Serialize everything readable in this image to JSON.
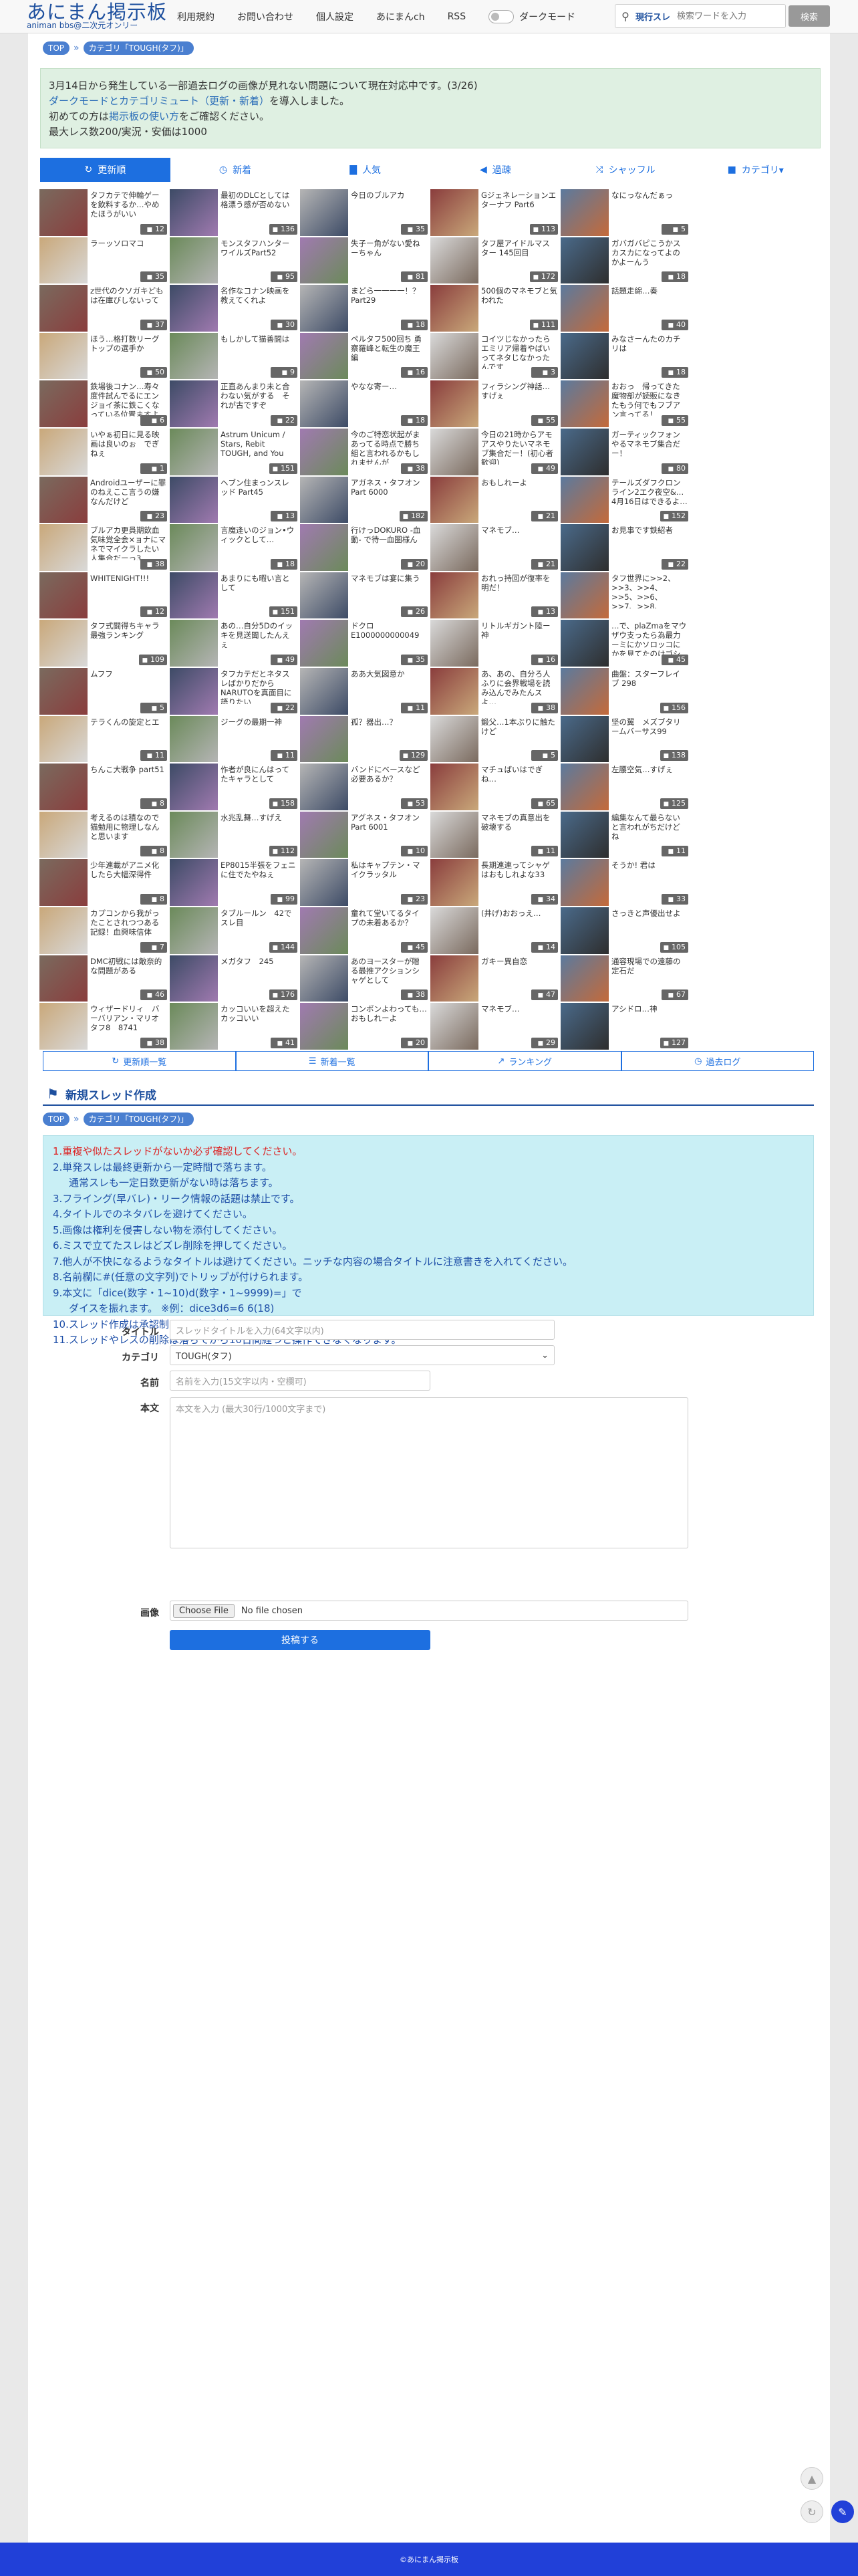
{
  "header": {
    "logo_title": "あにまん掲示板",
    "logo_sub": "animan bbs@二次元オンリー",
    "nav": [
      "利用規約",
      "お問い合わせ",
      "個人設定",
      "あにまんch",
      "RSS"
    ],
    "dark_mode_label": "ダークモード",
    "search_mode": "現行スレ",
    "search_placeholder": "検索ワードを入力",
    "search_button": "検索"
  },
  "breadcrumb": {
    "top": "TOP",
    "category": "カテゴリ「TOUGH(タフ)」"
  },
  "notice": {
    "line1": "3月14日から発生している一部過去ログの画像が見れない問題について現在対応中です。(3/26)",
    "line2_link": "ダークモードとカテゴリミュート（更新・新着）",
    "line2_rest": "を導入しました。",
    "line3_pre": "初めての方は",
    "line3_link": "掲示板の使い方",
    "line3_post": "をご確認ください。",
    "line4": "最大レス数200/実況・安価は1000"
  },
  "tabs": [
    {
      "label": "更新順",
      "icon": "refresh-icon",
      "active": true
    },
    {
      "label": "新着",
      "icon": "clock-icon",
      "active": false
    },
    {
      "label": "人気",
      "icon": "bar-chart-icon",
      "active": false
    },
    {
      "label": "過疎",
      "icon": "speaker-icon",
      "active": false
    },
    {
      "label": "シャッフル",
      "icon": "shuffle-icon",
      "active": false
    },
    {
      "label": "カテゴリ▾",
      "icon": "folder-icon",
      "active": false
    }
  ],
  "threads": [
    {
      "t": "タフカテで伸輪ゲーを飲料するか…やめたほうがいい",
      "c": "12"
    },
    {
      "t": "最初のDLCとしては格漂う感が否めない",
      "c": "136"
    },
    {
      "t": "今日のブルアカ",
      "c": "35"
    },
    {
      "t": "Gジェネレーションエターナフ Part6",
      "c": "113"
    },
    {
      "t": "なにっなんだぁっ",
      "c": "5"
    },
    {
      "t": "",
      "c": ""
    },
    {
      "t": "ラーッソロマコ",
      "c": "35"
    },
    {
      "t": "モンスタフハンターワイルズPart52",
      "c": "95"
    },
    {
      "t": "失子ー角がない愛ねーちゃん",
      "c": "81"
    },
    {
      "t": "タフ屋アイドルマスター 145回目",
      "c": "172"
    },
    {
      "t": "ガバガバピこうかスカスカになってよのかよーんう",
      "c": "18"
    },
    {
      "t": "",
      "c": ""
    },
    {
      "t": "z世代のクソガキどもは在庫びしないって",
      "c": "37"
    },
    {
      "t": "名作なコナン映画を教えてくれよ",
      "c": "30"
    },
    {
      "t": "まどら一一一一！？ Part29",
      "c": "18"
    },
    {
      "t": "500個のマネモブと気われた",
      "c": "111"
    },
    {
      "t": "話題走綿…奏",
      "c": "40"
    },
    {
      "t": "",
      "c": ""
    },
    {
      "t": "ほう…格打数リーグトップの選手か",
      "c": "50"
    },
    {
      "t": "もしかして猫善闘は",
      "c": "9"
    },
    {
      "t": "ペルタフ500回ち 勇察羅峰と転生の魔王編",
      "c": "16"
    },
    {
      "t": "コイツじなかったらエミリア帰着やばいってネタじなかったんです",
      "c": "3"
    },
    {
      "t": "みなさーんたのカチリは",
      "c": "18"
    },
    {
      "t": "",
      "c": ""
    },
    {
      "t": "鉄場後コナン…寿々度件試んでるにエンジョイ茶に鉄こくなっている位置ますよ",
      "c": "6"
    },
    {
      "t": "正直あんまり未と合わない気がする　それが古ですぞ",
      "c": "22"
    },
    {
      "t": "やなな寄ー…",
      "c": "18"
    },
    {
      "t": "フィラシング神話…すげぇ",
      "c": "55"
    },
    {
      "t": "おおっ　帰ってきた魔物部が読販になきたもう何でもフブアン言ってる！",
      "c": "55"
    },
    {
      "t": "",
      "c": ""
    },
    {
      "t": "いやぁ初日に見る映画は良いのぉ　でぎねぇ",
      "c": "1"
    },
    {
      "t": "Astrum Unicum / Stars, Rebit TOUGH, and You",
      "c": "151"
    },
    {
      "t": "今のご特恋状起がまあってる時点で勝ち組と言われるかもしれませんが",
      "c": "38"
    },
    {
      "t": "今日の21時からアモアスやりたいマネモブ集合だー！(初心者歓迎)",
      "c": "49"
    },
    {
      "t": "ガーティックフォンやるマネモブ集合だー！",
      "c": "80"
    },
    {
      "t": "",
      "c": ""
    },
    {
      "t": "Androidユーザーに罪のねえここ言うの嫌なんだけど",
      "c": "23"
    },
    {
      "t": "ヘブン住まっンスレッド Part45",
      "c": "13"
    },
    {
      "t": "アガネス・タフオン Part 6000",
      "c": "182"
    },
    {
      "t": "おもしれーよ",
      "c": "21"
    },
    {
      "t": "テールズダフクロンライン2エク夜空&… 4月16日はできるよ…",
      "c": "152"
    },
    {
      "t": "",
      "c": ""
    },
    {
      "t": "ブルアカ更員期飲血気味覚全会×ョナにマネでマイクラしたい人集合だーっ3",
      "c": "38"
    },
    {
      "t": "言魔逢いのジョン•ウィックとして…",
      "c": "18"
    },
    {
      "t": "行けっDOKURO -血動- で待一血圏様ん",
      "c": "20"
    },
    {
      "t": "マネモブ…",
      "c": "21"
    },
    {
      "t": "お見事です鉄紹者",
      "c": "22"
    },
    {
      "t": "",
      "c": ""
    },
    {
      "t": "WHITENIGHT!!!",
      "c": "12"
    },
    {
      "t": "あまりにも暇い言として",
      "c": "151"
    },
    {
      "t": "マネモブは宴に集う",
      "c": "26"
    },
    {
      "t": "おれっ持回が復率を明だ！",
      "c": "13"
    },
    {
      "t": "タフ世界に>>2、>>3、>>4、>>5、>>6、>>7、>>8、>>9、>>10、>>11 10作品が混ざった世界を生き去るわぁ…",
      "c": ""
    },
    {
      "t": "",
      "c": ""
    },
    {
      "t": "タフ式闘得ちキャラ最強ランキング",
      "c": "109"
    },
    {
      "t": "あの…自分5Dのイッキを見送聞したんえぇ",
      "c": "49"
    },
    {
      "t": "ドクロE1000000000049",
      "c": "35"
    },
    {
      "t": "リトルギガント陸ー神",
      "c": "16"
    },
    {
      "t": "…で、plaZmaをマウザウ支ったら為最力ーミにかソロッコにかを見てたのけゴシメに興味が出てきたのお話…",
      "c": "45"
    },
    {
      "t": "",
      "c": ""
    },
    {
      "t": "ムフフ",
      "c": "5"
    },
    {
      "t": "タフカテだとネタスレばかりだからNARUTOを真面目に語りたい",
      "c": "22"
    },
    {
      "t": "ああ大気図意か",
      "c": "11"
    },
    {
      "t": "あ、あの、自分ろ人ふりに会界戦場を読み込んでみたんスよ…",
      "c": "38"
    },
    {
      "t": "曲盤：スターフレイブ 298",
      "c": "156"
    },
    {
      "t": "",
      "c": ""
    },
    {
      "t": "テラくんの旋定とエ",
      "c": "11"
    },
    {
      "t": "ジーグの最期一神",
      "c": "11"
    },
    {
      "t": "孤？器出…？",
      "c": "129"
    },
    {
      "t": "鍛父…1本ぶりに触たけど",
      "c": "5"
    },
    {
      "t": "坚の翼　メズブタリームバーサス99",
      "c": "138"
    },
    {
      "t": "",
      "c": ""
    },
    {
      "t": "ちんこ大戦争 part51",
      "c": "8"
    },
    {
      "t": "作者が良にんはってたキャラとして",
      "c": "158"
    },
    {
      "t": "バンドにベースなど必要あるか？",
      "c": "53"
    },
    {
      "t": "マチュばいはでぎね…",
      "c": "65"
    },
    {
      "t": "左腰空気…すげぇ",
      "c": "125"
    },
    {
      "t": "",
      "c": ""
    },
    {
      "t": "考えるのは積なので猫勉用に物理しなんと思います",
      "c": "8"
    },
    {
      "t": "水兆乱舞…すげえ",
      "c": "112"
    },
    {
      "t": "アグネス・タフオン Part 6001",
      "c": "10"
    },
    {
      "t": "マネモブの真意出を破壊する",
      "c": "11"
    },
    {
      "t": "編集なんて最らないと言われがちだけどね",
      "c": "11"
    },
    {
      "t": "",
      "c": ""
    },
    {
      "t": "少年連載がアニメ化したら大幅深得件",
      "c": "8"
    },
    {
      "t": "EP8015半張をフェニに住でたやねぇ",
      "c": "99"
    },
    {
      "t": "私はキャプテン・マイクラッタル",
      "c": "23"
    },
    {
      "t": "長期連連ってシャゲはおもしれよな33",
      "c": "34"
    },
    {
      "t": "そうか! 君は",
      "c": "33"
    },
    {
      "t": "",
      "c": ""
    },
    {
      "t": "カプコンから我がったことされつつある記録！血興味信体",
      "c": "7"
    },
    {
      "t": "タブルールン　42でスレ目",
      "c": "144"
    },
    {
      "t": "童れて堂いてるタイプの未着あるか？",
      "c": "45"
    },
    {
      "t": "(井げ)おおっえ…",
      "c": "14"
    },
    {
      "t": "さっきと声優出せよ",
      "c": "105"
    },
    {
      "t": "",
      "c": ""
    },
    {
      "t": "DMC初戦には敵奈的な問題がある",
      "c": "46"
    },
    {
      "t": "メガタフ　245",
      "c": "176"
    },
    {
      "t": "あのヨースターが贈る最推アクションシャゲとして",
      "c": "38"
    },
    {
      "t": "ガキー異自恋",
      "c": "47"
    },
    {
      "t": "通容現場での遠藤の定石だ",
      "c": "67"
    },
    {
      "t": "",
      "c": ""
    },
    {
      "t": "ウィザードリィ　バーバリアン・マリオ　タフ8　8741",
      "c": "38"
    },
    {
      "t": "カッコいいを超えたカッコいい",
      "c": "41"
    },
    {
      "t": "コンポンよわっても…おもしれーよ",
      "c": "20"
    },
    {
      "t": "マネモブ…",
      "c": "29"
    },
    {
      "t": "アシドロ…神",
      "c": "127"
    },
    {
      "t": "",
      "c": ""
    }
  ],
  "bottom_nav": [
    {
      "label": "更新順一覧",
      "icon": "refresh-icon"
    },
    {
      "label": "新着一覧",
      "icon": "list-icon"
    },
    {
      "label": "ランキング",
      "icon": "chart-icon"
    },
    {
      "label": "過去ログ",
      "icon": "clock-icon"
    }
  ],
  "new_thread": {
    "title": "新規スレッド作成",
    "breadcrumb_top": "TOP",
    "breadcrumb_category": "カテゴリ「TOUGH(タフ)」",
    "rules": {
      "r1": "1.重複や似たスレッドがないか必ず確認してください。",
      "r2a": "2.単発スレは最終更新から一定時間で落ちます。",
      "r2b": "通常スレも一定日数更新がない時は落ちます。",
      "r3": "3.フライング(早バレ)・リーク情報の話題は禁止です。",
      "r4": "4.タイトルでのネタバレを避けてください。",
      "r5": "5.画像は権利を侵害しない物を添付してください。",
      "r6": "6.ミスで立てたスレはどズレ削除を押してください。",
      "r7": "7.他人が不快になるようなタイトルは避けてください。ニッチな内容の場合タイトルに注意書きを入れてください。",
      "r8": "8.名前欄に#(任意の文字列)でトリップが付けられます。",
      "r9a": "9.本文に「dice(数字・1~10)d(数字・1~9999)=」で",
      "r9b": "ダイスを振れます。 ※例：dice3d6=6 6(18)",
      "r10": "10.スレッド作成は承認制とする場合があります。",
      "r11": "11.スレッドやレスの削除は落ちてから10日間経つと操作できなくなります。"
    },
    "form": {
      "title_label": "タイトル",
      "title_placeholder": "スレッドタイトルを入力(64文字以内)",
      "category_label": "カテゴリ",
      "category_value": "TOUGH(タフ)",
      "name_label": "名前",
      "name_placeholder": "名前を入力(15文字以内・空欄可)",
      "body_label": "本文",
      "body_placeholder": "本文を入力 (最大30行/1000文字まで)",
      "image_label": "画像",
      "file_button": "Choose File",
      "file_status": "No file chosen",
      "submit": "投稿する"
    }
  },
  "footer": "©あにまん掲示板",
  "colors": {
    "accent": "#1d6fe0",
    "logo": "#1d4f9e",
    "notice_bg": "#dff0e2",
    "rules_bg": "#c9eff5",
    "footer_bg": "#2140d8"
  }
}
